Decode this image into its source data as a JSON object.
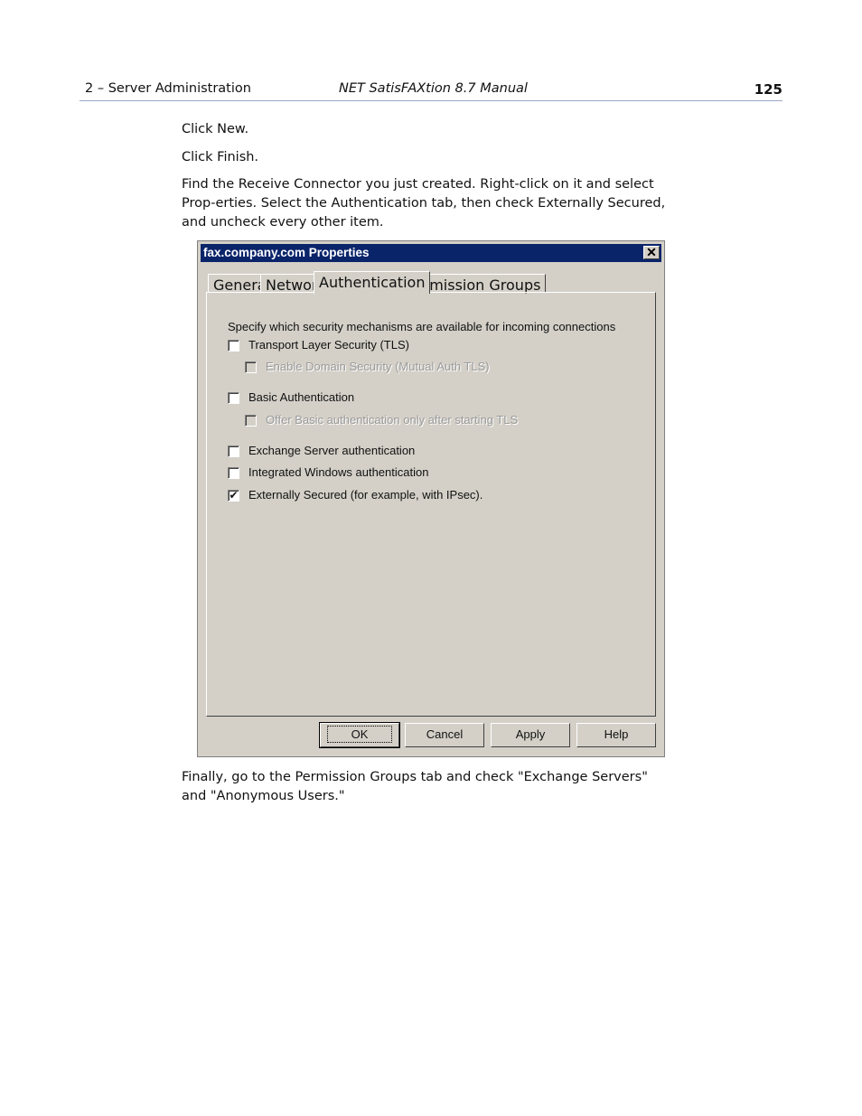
{
  "header": {
    "section": "2 – Server Administration",
    "manual_title": "NET SatisFAXtion 8.7 Manual",
    "page_number": "125"
  },
  "steps": [
    "Click New.",
    "Click Finish.",
    "Find the Receive Connector you just created. Right-click on it and select Prop-erties. Select the Authentication tab, then check Externally Secured, and uncheck every other item."
  ],
  "dialog": {
    "title": "fax.company.com Properties",
    "close_glyph": "✕",
    "tabs": [
      "General",
      "Network",
      "Authentication",
      "Permission Groups"
    ],
    "active_tab": "Authentication",
    "prompt": "Specify which security mechanisms are available for incoming connections",
    "options": [
      {
        "label": "Transport Layer Security (TLS)",
        "checked": false,
        "enabled": true
      },
      {
        "label": "Enable Domain Security (Mutual Auth TLS)",
        "checked": false,
        "enabled": false
      },
      {
        "label": "Basic Authentication",
        "checked": false,
        "enabled": true
      },
      {
        "label": "Offer Basic authentication only after starting TLS",
        "checked": false,
        "enabled": false
      },
      {
        "label": "Exchange Server authentication",
        "checked": false,
        "enabled": true
      },
      {
        "label": "Integrated Windows authentication",
        "checked": false,
        "enabled": true
      },
      {
        "label": "Externally Secured (for example, with IPsec).",
        "checked": true,
        "enabled": true
      }
    ],
    "check_glyph": "✔",
    "buttons": [
      "OK",
      "Cancel",
      "Apply",
      "Help"
    ]
  },
  "closing": "Finally, go to the Permission Groups tab and check \"Exchange Servers\" and \"Anonymous Users.\""
}
